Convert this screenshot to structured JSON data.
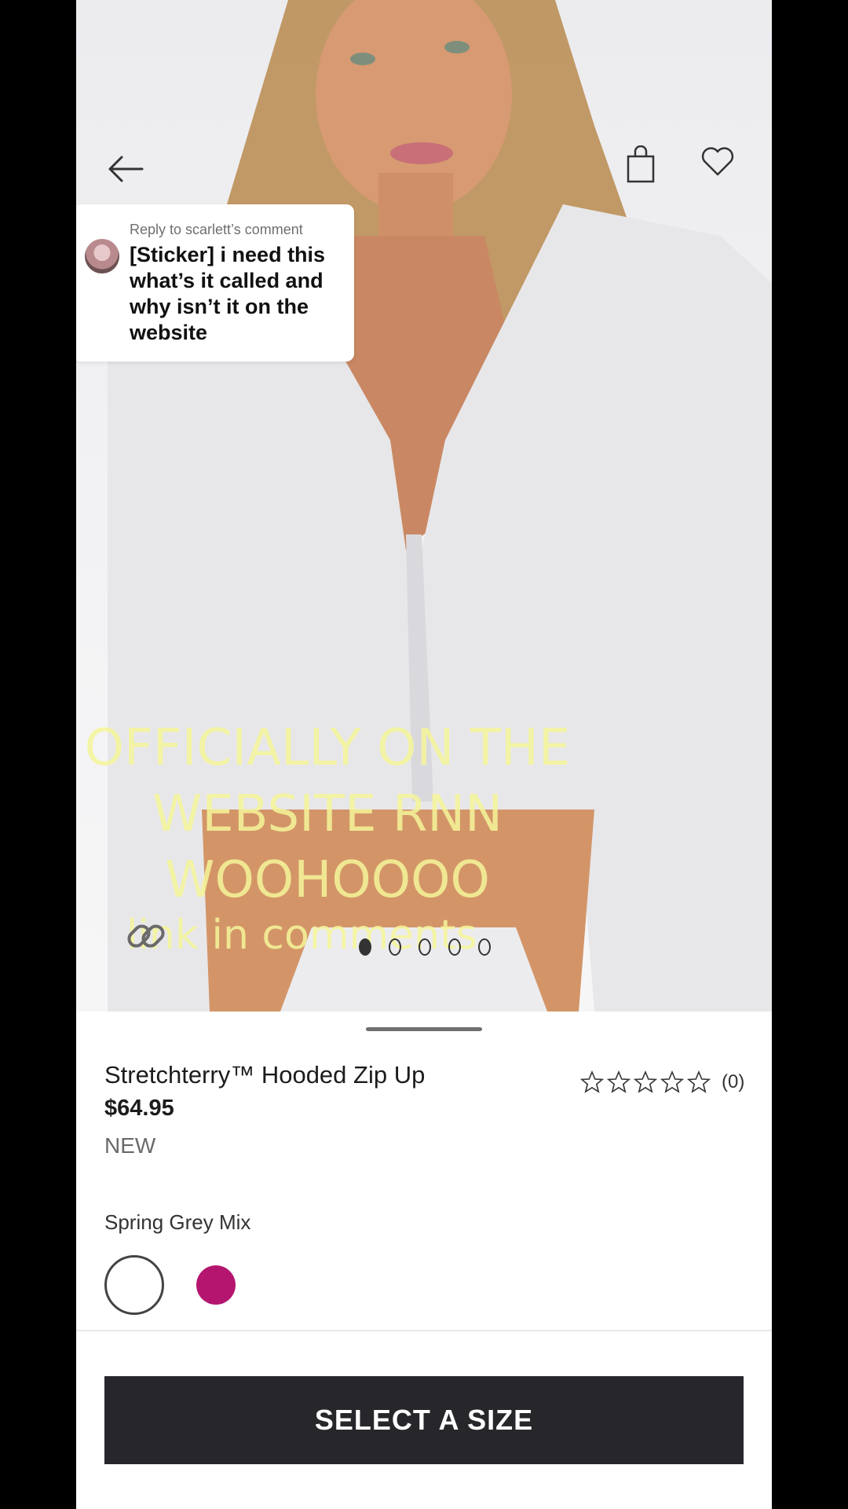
{
  "reply": {
    "meta": "Reply to scarlett’s comment",
    "text": "[Sticker] i need this what’s it called and why isn’t it on the website"
  },
  "overlay": {
    "headline": "OFFICIALLY ON THE WEBSITE RNN WOOHOOOO",
    "link_text": "link in comments"
  },
  "carousel": {
    "page_count": 5,
    "active_index": 0
  },
  "product": {
    "title": "Stretchterry™ Hooded Zip Up",
    "price": "$64.95",
    "badge": "NEW",
    "rating_count": "(0)",
    "rating_stars": 0,
    "color_name": "Spring Grey Mix",
    "swatches": [
      "#ffffff",
      "#b4166f"
    ]
  },
  "cta": {
    "label": "SELECT A SIZE"
  },
  "icons": [
    "back-arrow-icon",
    "shopping-bag-icon",
    "heart-icon",
    "link-icon",
    "star-icon"
  ]
}
